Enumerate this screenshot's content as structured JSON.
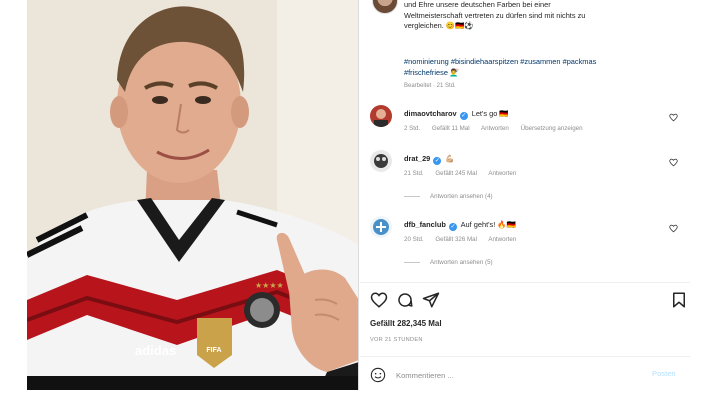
{
  "post": {
    "caption_lines": [
      "und Ehre unsere deutschen Farben bei einer",
      "Weltmeisterschaft vertreten zu dürfen sind mit nichts zu",
      "vergleichen. 😊🇩🇪⚽"
    ],
    "hashtags_lines": [
      "#nominierung #bisindiehaarspitzen #zusammen #packmas",
      "#frischefriese 💇‍♂️"
    ],
    "edited_label": "Bearbeitet · 21 Std."
  },
  "comments": [
    {
      "username": "dimaovtcharov",
      "text": "Let's go 🇩🇪",
      "time": "2 Std.",
      "likes": "Gefällt 11 Mal",
      "reply_label": "Antworten",
      "translate_label": "Übersetzung anzeigen"
    },
    {
      "username": "drat_29",
      "text": "💪🏼",
      "time": "21 Std.",
      "likes": "Gefällt 245 Mal",
      "reply_label": "Antworten",
      "view_replies": "Antworten ansehen (4)"
    },
    {
      "username": "dfb_fanclub",
      "text": "Auf geht's! 🔥🇩🇪",
      "time": "20 Std.",
      "likes": "Gefällt 326 Mal",
      "reply_label": "Antworten",
      "view_replies": "Antworten ansehen (5)"
    }
  ],
  "photo_text": {
    "brand": "adidas",
    "crest": "FIFA"
  },
  "likes_label": "Gefällt 282,345 Mal",
  "post_time": "VOR 21 STUNDEN",
  "comment_box": {
    "placeholder": "Kommentieren ...",
    "post_label": "Posten"
  },
  "colors": {
    "link": "#00376b",
    "verified": "#3897f0",
    "muted": "#8e8e8e",
    "jersey_red": "#b8141c"
  },
  "icons": [
    "heart-icon",
    "comment-icon",
    "share-icon",
    "bookmark-icon",
    "smiley-icon",
    "verified-badge-icon"
  ]
}
